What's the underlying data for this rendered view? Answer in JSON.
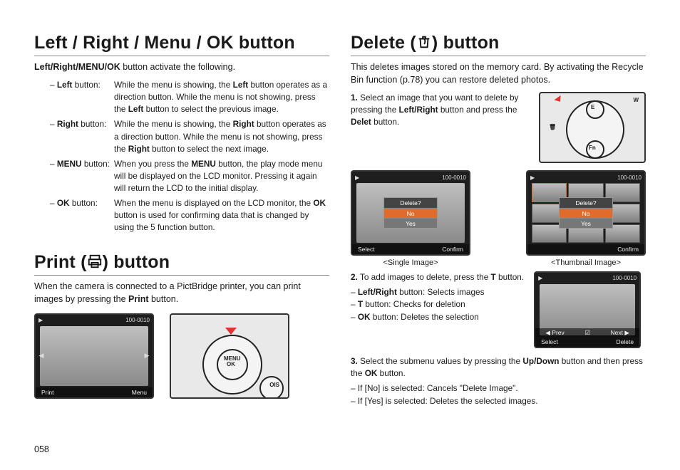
{
  "page_number": "058",
  "left_column": {
    "section1": {
      "title": "Left / Right / Menu / OK button",
      "lead_prefix_bold": "Left/Right/MENU/OK",
      "lead_rest": " button activate the following.",
      "defs": [
        {
          "label_prefix": "– ",
          "label_bold": "Left",
          "label_suffix": " button:",
          "desc_parts": [
            "While the menu is showing, the ",
            "Left",
            " button operates as a direction button. While the menu is not showing, press the ",
            "Left",
            " button to select the previous image."
          ]
        },
        {
          "label_prefix": "– ",
          "label_bold": "Right",
          "label_suffix": " button:",
          "desc_parts": [
            "While the menu is showing, the ",
            "Right",
            " button operates as a direction button. While the menu is not showing, press the ",
            "Right",
            " button to select the next image."
          ]
        },
        {
          "label_prefix": "– ",
          "label_bold": "MENU",
          "label_suffix": " button:",
          "desc_parts": [
            "When you press the ",
            "MENU",
            " button, the play mode menu will be displayed on the LCD monitor. Pressing it again will return the LCD to the initial display."
          ]
        },
        {
          "label_prefix": "– ",
          "label_bold": "OK",
          "label_suffix": " button:",
          "desc_parts": [
            "When the menu is displayed on the LCD monitor, the ",
            "OK",
            " button is used for confirming data that is changed by using the 5 function button."
          ]
        }
      ]
    },
    "section2": {
      "title_pre": "Print (",
      "title_post": ") button",
      "icon_name": "printer-icon",
      "lead": "When the camera is connected to a PictBridge printer, you can print images by pressing the ",
      "lead_bold": "Print",
      "lead_end": " button.",
      "lcd_top_right": "100-0010",
      "lcd_bottom_left": "Print",
      "lcd_bottom_right": "Menu",
      "diagram_center_label": "MENU\nOK"
    }
  },
  "right_column": {
    "section1": {
      "title_pre": "Delete (",
      "title_post": ") button",
      "icon_name": "trash-icon",
      "lead": "This deletes images stored on the memory card. By activating the Recycle Bin function (p.78) you can restore deleted photos.",
      "step1": {
        "num": "1.",
        "text_pre": "Select an image that you want to delete by pressing the ",
        "text_bold1": "Left/Right",
        "text_mid": " button and press the ",
        "text_bold2": "Delet",
        "text_end": " button.",
        "diagram_labels": {
          "w": "W",
          "fn": "Fn",
          "e": "E"
        }
      },
      "fig_row": {
        "lcd_top_right": "100-0010",
        "dialog_title": "Delete?",
        "dialog_opt1": "No",
        "dialog_opt2": "Yes",
        "bottom_left": "Select",
        "bottom_right": "Confirm",
        "caption_single": "<Single Image>",
        "caption_thumb": "<Thumbnail Image>"
      },
      "step2": {
        "num": "2.",
        "text_pre": "To add images to delete, press the ",
        "text_bold": "T",
        "text_end": " button.",
        "sub": [
          {
            "bold": "Left/Right",
            "rest": " button: Selects images"
          },
          {
            "bold": "T",
            "rest": " button: Checks for deletion"
          },
          {
            "bold": "OK",
            "rest": " button: Deletes the selection"
          }
        ],
        "fig": {
          "lcd_top_right": "100-0010",
          "mid_left": "Prev",
          "mid_right": "Next",
          "bottom_left": "Select",
          "bottom_right": "Delete"
        }
      },
      "step3": {
        "num": "3.",
        "text_pre": "Select the submenu values by pressing the ",
        "text_bold1": "Up/Down",
        "text_mid": " button and then press the ",
        "text_bold2": "OK",
        "text_end": " button.",
        "sub": [
          "If [No] is selected: Cancels \"Delete Image\".",
          "If [Yes] is selected: Deletes the selected images."
        ]
      }
    }
  }
}
